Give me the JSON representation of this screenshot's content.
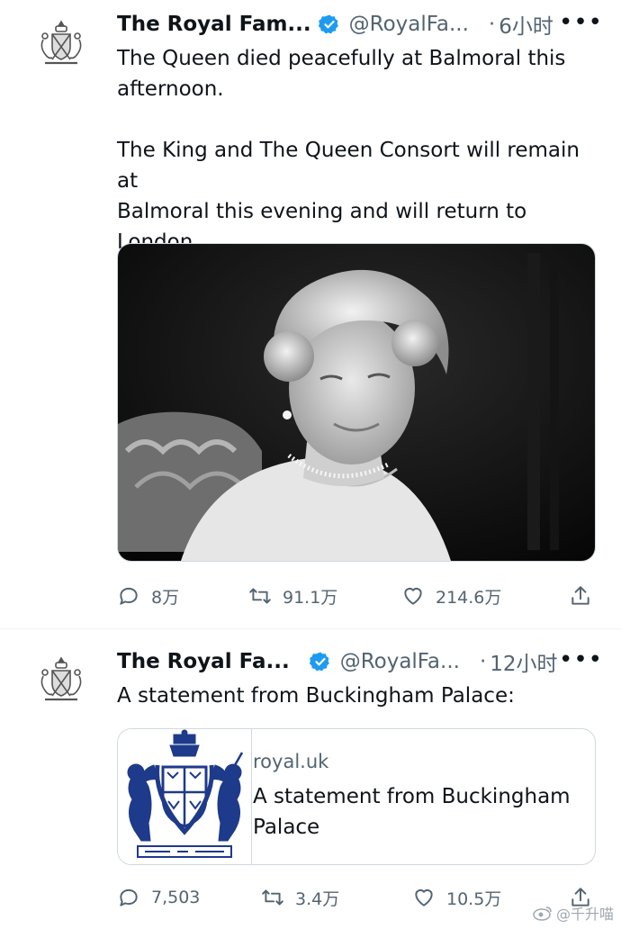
{
  "tweets": [
    {
      "name": "The Royal Fam...",
      "handle": "@RoyalFa...",
      "dot": "·",
      "time": "6小时",
      "more": "•••",
      "text": "The Queen died peacefully at Balmoral this\nafternoon.\n\nThe King and The Queen Consort will remain at\nBalmoral this evening and will return to London\ntomorrow.",
      "replies": "8万",
      "retweets": "91.1万",
      "likes": "214.6万"
    },
    {
      "name": "The Royal Fa...",
      "handle": "@RoyalFa...",
      "dot": "·",
      "time": "12小时",
      "more": "•••",
      "text": "A statement from Buckingham Palace:",
      "card": {
        "domain": "royal.uk",
        "title": "A statement from Buckingham\nPalace"
      },
      "replies": "7,503",
      "retweets": "3.4万",
      "likes": "10.5万"
    }
  ],
  "watermark": "@千升喵",
  "icons": [
    "coat-of-arms-icon",
    "verified-badge-icon",
    "more-icon",
    "reply-icon",
    "retweet-icon",
    "like-icon",
    "share-icon",
    "weibo-icon"
  ],
  "colors": {
    "verified": "#1d9bf0",
    "secondary_text": "#536471",
    "card_border": "#cfd9de",
    "crest_blue": "#1e3a8a"
  }
}
